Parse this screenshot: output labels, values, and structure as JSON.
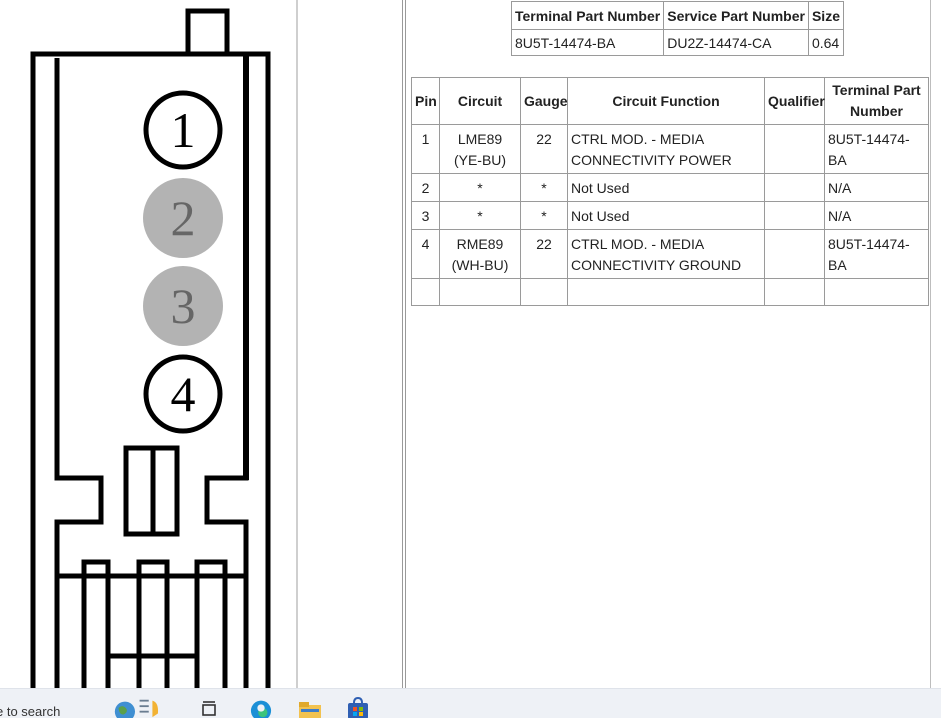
{
  "connector": {
    "pin_labels": [
      "1",
      "2",
      "3",
      "4"
    ],
    "used_pins": [
      "1",
      "4"
    ],
    "unused_pins": [
      "2",
      "3"
    ]
  },
  "terminal_summary": {
    "headers": [
      "Terminal Part Number",
      "Service Part Number",
      "Size"
    ],
    "rows": [
      [
        "8U5T-14474-BA",
        "DU2Z-14474-CA",
        "0.64"
      ]
    ]
  },
  "pin_table": {
    "headers": [
      "Pin",
      "Circuit",
      "Gauge",
      "Circuit Function",
      "Qualifier",
      "Terminal Part Number"
    ],
    "rows": [
      {
        "pin": "1",
        "circuit": "LME89 (YE-BU)",
        "gauge": "22",
        "function": "CTRL MOD. - MEDIA CONNECTIVITY POWER",
        "qualifier": "",
        "terminal": "8U5T-14474-BA"
      },
      {
        "pin": "2",
        "circuit": "*",
        "gauge": "*",
        "function": "Not Used",
        "qualifier": "",
        "terminal": "N/A"
      },
      {
        "pin": "3",
        "circuit": "*",
        "gauge": "*",
        "function": "Not Used",
        "qualifier": "",
        "terminal": "N/A"
      },
      {
        "pin": "4",
        "circuit": "RME89 (WH-BU)",
        "gauge": "22",
        "function": "CTRL MOD. - MEDIA CONNECTIVITY GROUND",
        "qualifier": "",
        "terminal": "8U5T-14474-BA"
      }
    ]
  },
  "taskbar": {
    "search_text": "e to search",
    "icons": [
      "weather-icon",
      "task-view-icon",
      "edge-browser-icon",
      "file-explorer-icon",
      "store-icon"
    ]
  },
  "colors": {
    "unused_pin_fill": "#b3b3b3",
    "outline": "#000000",
    "grid_line": "#9a9a9a"
  }
}
